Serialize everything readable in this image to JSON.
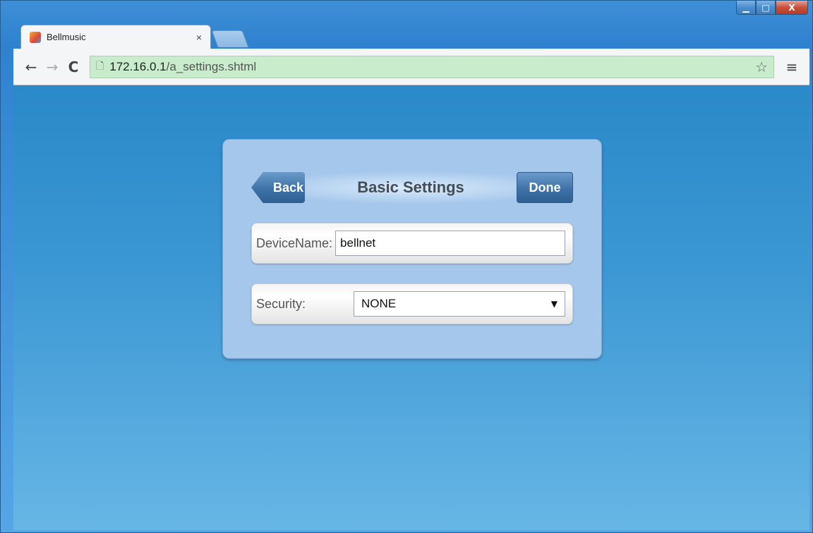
{
  "browser": {
    "tab_title": "Bellmusic",
    "tab_close": "×",
    "url_host": "172.16.0.1",
    "url_path": "/a_settings.shtml",
    "icons": {
      "back": "←",
      "forward": "→",
      "reload": "C",
      "page": "🗋",
      "star": "☆",
      "menu": "≡",
      "minimize": "▁",
      "maximize": "□",
      "close": "X"
    }
  },
  "page": {
    "title": "Basic Settings",
    "back_label": "Back",
    "done_label": "Done",
    "device_name_label": "DeviceName:",
    "device_name_value": "bellnet",
    "security_label": "Security:",
    "security_value": "NONE",
    "select_arrow": "▼"
  }
}
